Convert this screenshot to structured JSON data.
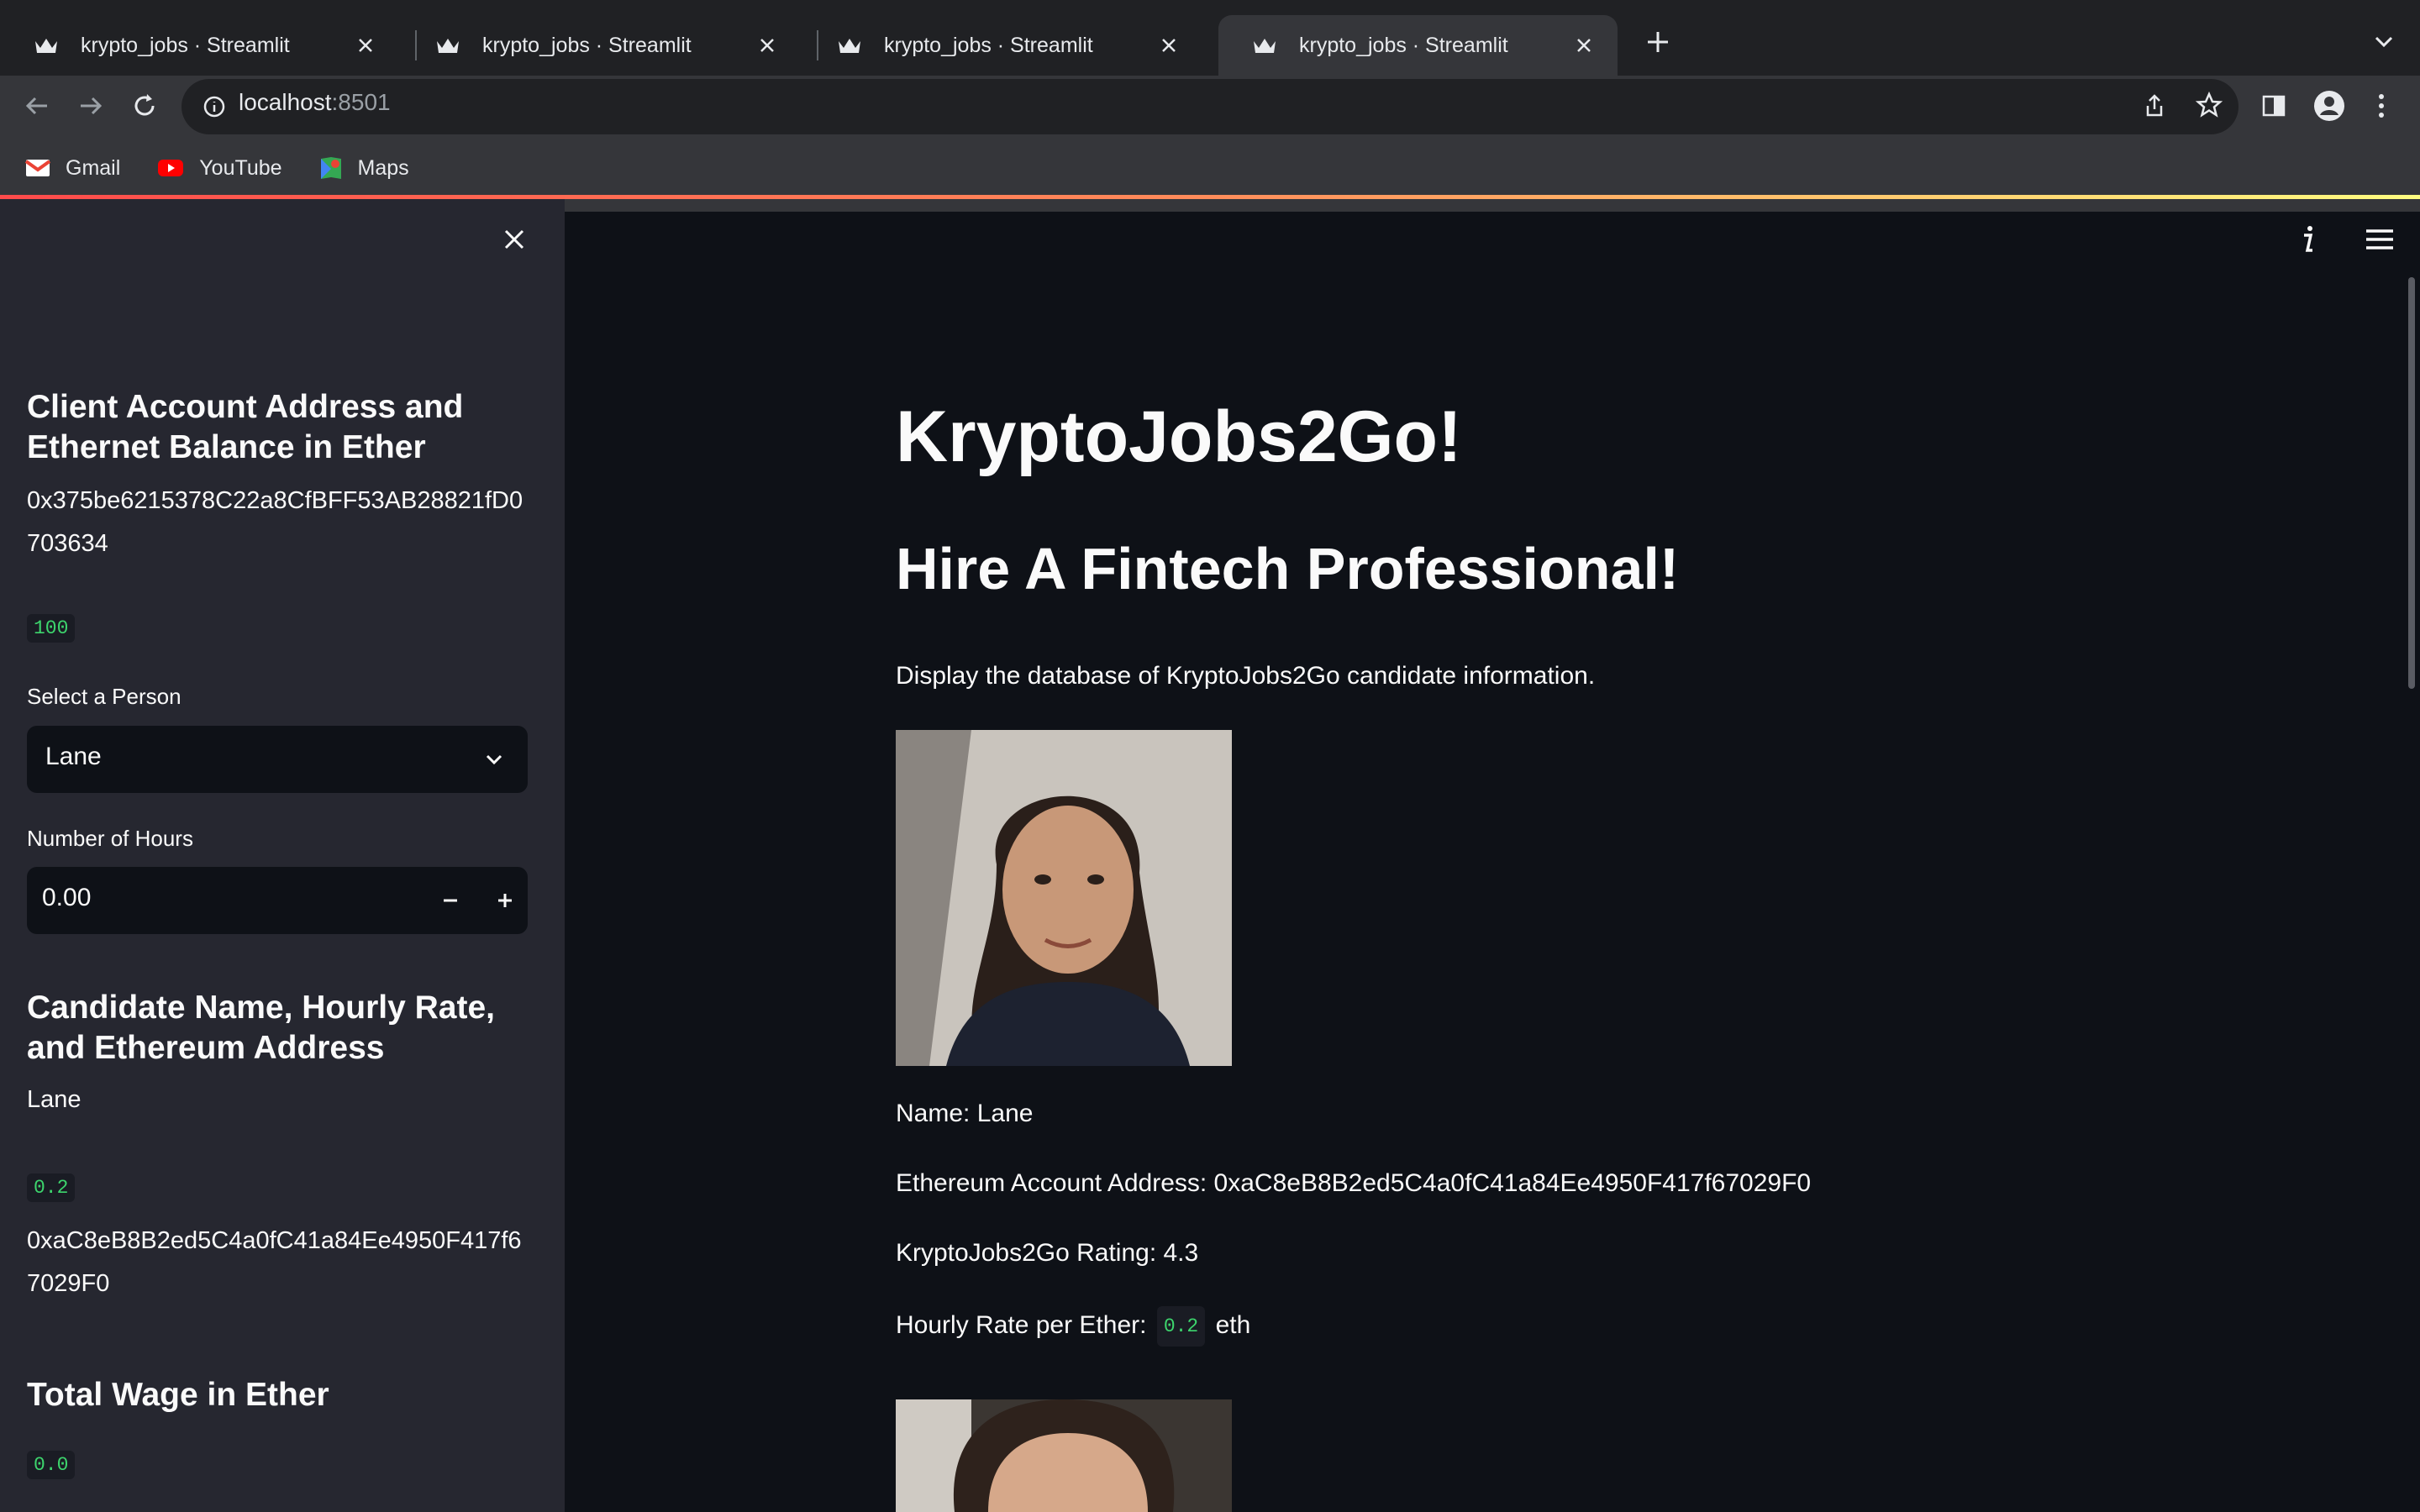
{
  "browser": {
    "tabs": [
      {
        "title": "krypto_jobs · Streamlit",
        "active": false
      },
      {
        "title": "krypto_jobs · Streamlit",
        "active": false
      },
      {
        "title": "krypto_jobs · Streamlit",
        "active": false
      },
      {
        "title": "krypto_jobs · Streamlit",
        "active": true
      }
    ],
    "url_host": "localhost",
    "url_port": ":8501",
    "bookmarks": [
      "Gmail",
      "YouTube",
      "Maps"
    ]
  },
  "sidebar": {
    "account_heading": "Client Account Address and Ethernet Balance in Ether",
    "account_address": "0x375be6215378C22a8CfBFF53AB28821fD0703634",
    "balance": "100",
    "select_label": "Select a Person",
    "select_value": "Lane",
    "hours_label": "Number of Hours",
    "hours_value": "0.00",
    "candidate_heading": "Candidate Name, Hourly Rate, and Ethereum Address",
    "candidate_name": "Lane",
    "candidate_rate": "0.2",
    "candidate_address": "0xaC8eB8B2ed5C4a0fC41a84Ee4950F417f67029F0",
    "wage_heading": "Total Wage in Ether",
    "wage_value": "0.0"
  },
  "main": {
    "title": "KryptoJobs2Go!",
    "subtitle": "Hire A Fintech Professional!",
    "description": "Display the database of KryptoJobs2Go candidate information.",
    "candidate": {
      "name_line": "Name: Lane",
      "address_line": "Ethereum Account Address: 0xaC8eB8B2ed5C4a0fC41a84Ee4950F417f67029F0",
      "rating_line": "KryptoJobs2Go Rating: 4.3",
      "rate_prefix": "Hourly Rate per Ether:",
      "rate_value": "0.2",
      "rate_suffix": "eth"
    }
  },
  "colors": {
    "app_bg": "#0e1117",
    "sidebar_bg": "#262730",
    "code_green": "#3dd56d",
    "accent_red": "#ff4b4b"
  },
  "icons": [
    "crown-icon",
    "close-icon",
    "plus-icon",
    "chevron-down-icon",
    "back-icon",
    "forward-icon",
    "reload-icon",
    "info-icon",
    "share-icon",
    "star-icon",
    "side-panel-icon",
    "profile-icon",
    "kebab-menu-icon",
    "hamburger-menu-icon",
    "minus-icon"
  ]
}
